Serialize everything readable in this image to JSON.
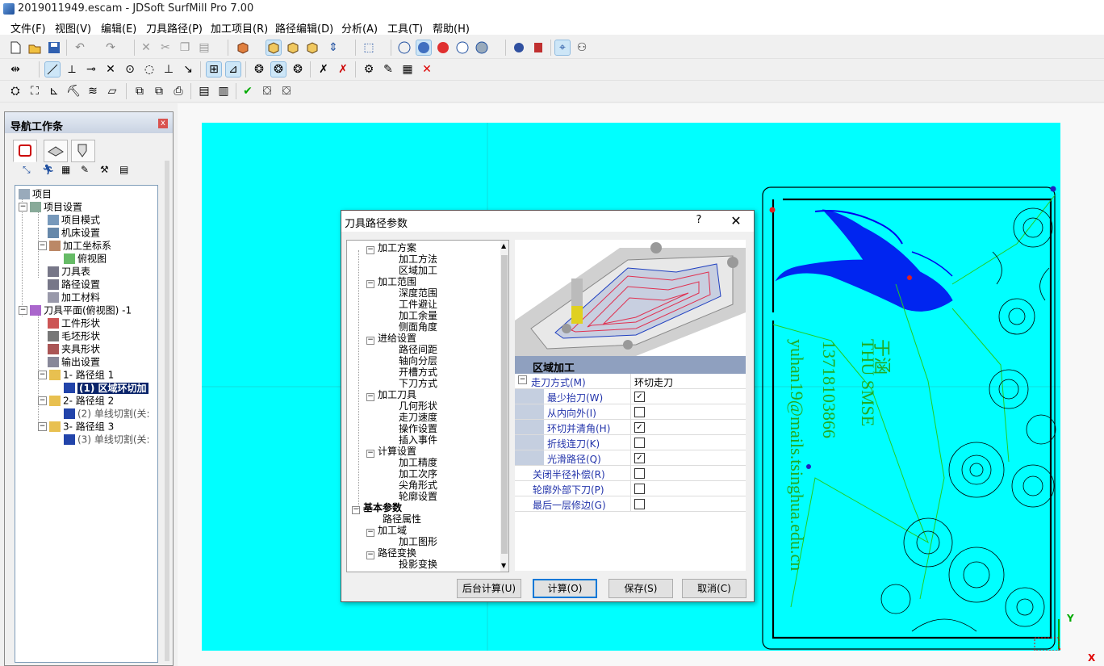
{
  "window": {
    "title": "2019011949.escam - JDSoft SurfMill Pro 7.00"
  },
  "menu": [
    {
      "label": "文件(F)"
    },
    {
      "label": "视图(V)"
    },
    {
      "label": "编辑(E)"
    },
    {
      "label": "刀具路径(P)"
    },
    {
      "label": "加工项目(R)"
    },
    {
      "label": "路径编辑(D)"
    },
    {
      "label": "分析(A)"
    },
    {
      "label": "工具(T)"
    },
    {
      "label": "帮助(H)"
    }
  ],
  "nav": {
    "title": "导航工作条",
    "close_label": "x",
    "tree": [
      {
        "label": "项目"
      },
      {
        "label": "项目设置"
      },
      {
        "label": "项目模式"
      },
      {
        "label": "机床设置"
      },
      {
        "label": "加工坐标系"
      },
      {
        "label": "俯视图"
      },
      {
        "label": "刀具表"
      },
      {
        "label": "路径设置"
      },
      {
        "label": "加工材料"
      },
      {
        "label": "刀具平面(俯视图) -1"
      },
      {
        "label": "工件形状"
      },
      {
        "label": "毛坯形状"
      },
      {
        "label": "夹具形状"
      },
      {
        "label": "输出设置"
      },
      {
        "label": "1- 路径组 1"
      },
      {
        "label": "(1) 区域环切加"
      },
      {
        "label": "2- 路径组 2"
      },
      {
        "label": "(2) 单线切割(关:"
      },
      {
        "label": "3- 路径组 3"
      },
      {
        "label": "(3) 单线切割(关:"
      }
    ]
  },
  "dialog": {
    "title": "刀具路径参数",
    "help_label": "?",
    "close_label": "✕",
    "tree": [
      {
        "label": "加工方案"
      },
      {
        "label": "加工方法"
      },
      {
        "label": "区域加工"
      },
      {
        "label": "加工范围"
      },
      {
        "label": "深度范围"
      },
      {
        "label": "工件避让"
      },
      {
        "label": "加工余量"
      },
      {
        "label": "侧面角度"
      },
      {
        "label": "进给设置"
      },
      {
        "label": "路径间距"
      },
      {
        "label": "轴向分层"
      },
      {
        "label": "开槽方式"
      },
      {
        "label": "下刀方式"
      },
      {
        "label": "加工刀具"
      },
      {
        "label": "几何形状"
      },
      {
        "label": "走刀速度"
      },
      {
        "label": "操作设置"
      },
      {
        "label": "插入事件"
      },
      {
        "label": "计算设置"
      },
      {
        "label": "加工精度"
      },
      {
        "label": "加工次序"
      },
      {
        "label": "尖角形式"
      },
      {
        "label": "轮廓设置"
      },
      {
        "label": "基本参数"
      },
      {
        "label": "路径属性"
      },
      {
        "label": "加工域"
      },
      {
        "label": "加工图形"
      },
      {
        "label": "路径变换"
      },
      {
        "label": "投影变换"
      }
    ],
    "grid": {
      "header": "区域加工",
      "rows": [
        {
          "name": "走刀方式(M)",
          "value": "环切走刀"
        },
        {
          "name": "最少抬刀(W)",
          "checked": true
        },
        {
          "name": "从内向外(I)",
          "checked": false
        },
        {
          "name": "环切并清角(H)",
          "checked": true
        },
        {
          "name": "折线连刀(K)",
          "checked": false
        },
        {
          "name": "光滑路径(Q)",
          "checked": true
        },
        {
          "name": "关闭半径补偿(R)",
          "checked": false
        },
        {
          "name": "轮廓外部下刀(P)",
          "checked": false
        },
        {
          "name": "最后一层修边(G)",
          "checked": false
        }
      ]
    },
    "buttons": {
      "background": "后台计算(U)",
      "compute": "计算(O)",
      "save": "保存(S)",
      "cancel": "取消(C)"
    }
  },
  "viewport": {
    "text": {
      "line1": "于涵",
      "line2": "THU SMSE",
      "line3": "13718103866",
      "line4": "yuhan19@mails.tsinghua.edu.cn"
    },
    "axis_y": "Y",
    "axis_x": "X"
  },
  "colors": {
    "viewport_bg": "#00ffff",
    "toolpath_green": "#22cc22",
    "drawing_blue": "#0000ff",
    "selection": "#0a246a"
  }
}
